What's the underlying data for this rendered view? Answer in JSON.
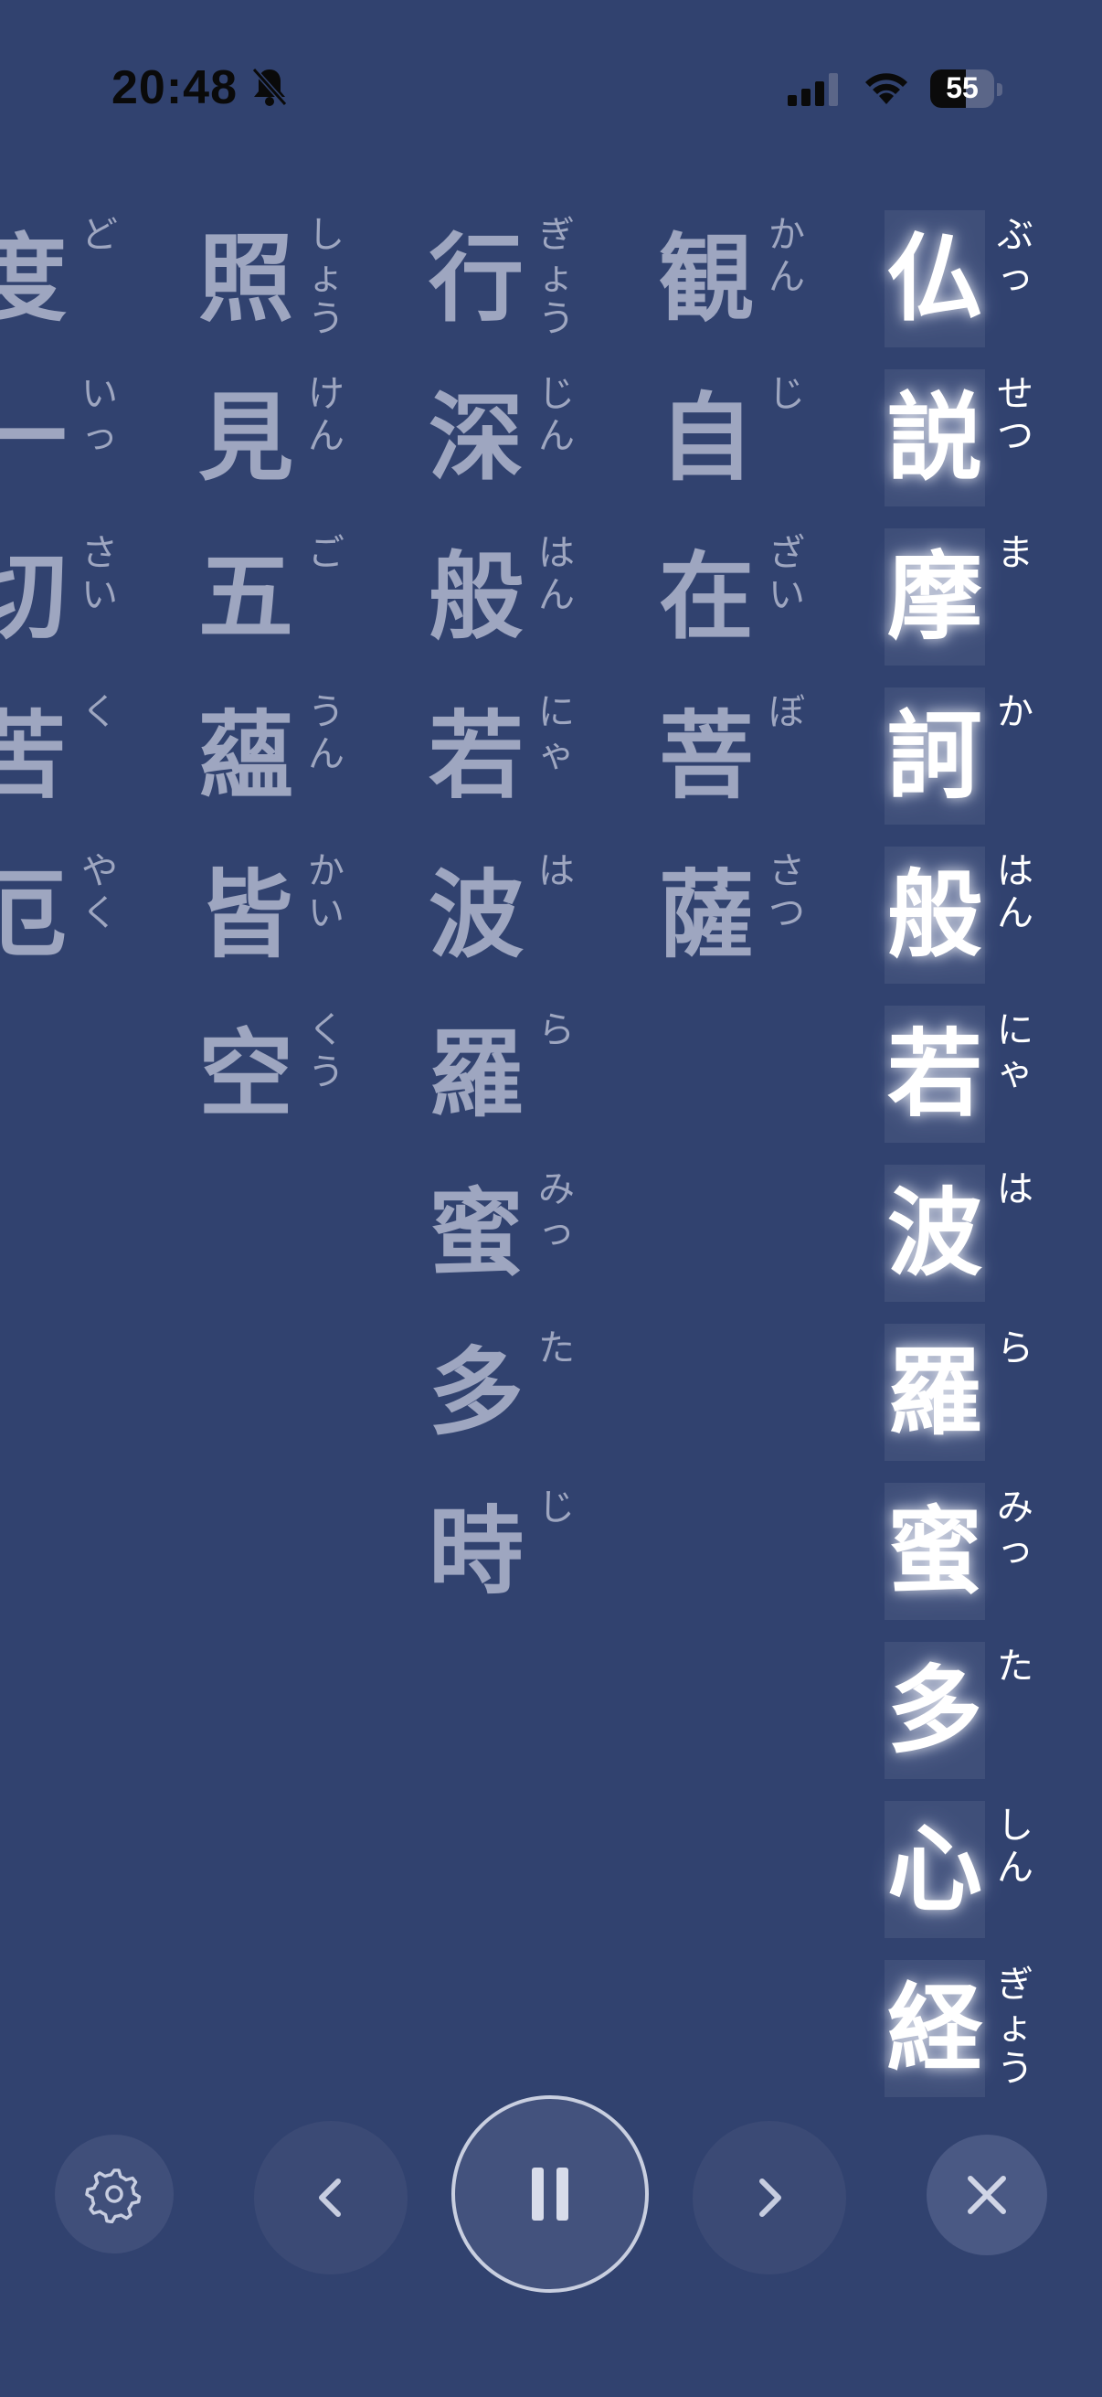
{
  "status": {
    "time": "20:48",
    "battery": "55"
  },
  "columns": [
    {
      "state": "active",
      "chars": [
        {
          "k": "仏",
          "r": "ぶっ"
        },
        {
          "k": "説",
          "r": "せつ"
        },
        {
          "k": "摩",
          "r": "ま"
        },
        {
          "k": "訶",
          "r": "か"
        },
        {
          "k": "般",
          "r": "はん"
        },
        {
          "k": "若",
          "r": "にゃ"
        },
        {
          "k": "波",
          "r": "は"
        },
        {
          "k": "羅",
          "r": "ら"
        },
        {
          "k": "蜜",
          "r": "みっ"
        },
        {
          "k": "多",
          "r": "た"
        },
        {
          "k": "心",
          "r": "しん"
        },
        {
          "k": "経",
          "r": "ぎょう"
        }
      ]
    },
    {
      "state": "dim",
      "chars": [
        {
          "k": "観",
          "r": "かん"
        },
        {
          "k": "自",
          "r": "じ"
        },
        {
          "k": "在",
          "r": "ざい"
        },
        {
          "k": "菩",
          "r": "ぼ"
        },
        {
          "k": "薩",
          "r": "さつ"
        }
      ]
    },
    {
      "state": "dim",
      "chars": [
        {
          "k": "行",
          "r": "ぎょう"
        },
        {
          "k": "深",
          "r": "じん"
        },
        {
          "k": "般",
          "r": "はん"
        },
        {
          "k": "若",
          "r": "にゃ"
        },
        {
          "k": "波",
          "r": "は"
        },
        {
          "k": "羅",
          "r": "ら"
        },
        {
          "k": "蜜",
          "r": "みっ"
        },
        {
          "k": "多",
          "r": "た"
        },
        {
          "k": "時",
          "r": "じ"
        }
      ]
    },
    {
      "state": "dim",
      "chars": [
        {
          "k": "照",
          "r": "しょう"
        },
        {
          "k": "見",
          "r": "けん"
        },
        {
          "k": "五",
          "r": "ご"
        },
        {
          "k": "蘊",
          "r": "うん"
        },
        {
          "k": "皆",
          "r": "かい"
        },
        {
          "k": "空",
          "r": "くう"
        }
      ]
    },
    {
      "state": "dim",
      "chars": [
        {
          "k": "度",
          "r": "ど"
        },
        {
          "k": "一",
          "r": "いっ"
        },
        {
          "k": "切",
          "r": "さい"
        },
        {
          "k": "苦",
          "r": "く"
        },
        {
          "k": "厄",
          "r": "やく"
        }
      ]
    }
  ],
  "controls": {
    "settings_icon": "gear-icon",
    "prev_icon": "chevron-left-icon",
    "play_icon": "pause-icon",
    "next_icon": "chevron-right-icon",
    "close_icon": "close-icon"
  },
  "colors": {
    "background": "#31426f",
    "active_text": "#ffffff",
    "dim_text": "#9ea6c0"
  }
}
